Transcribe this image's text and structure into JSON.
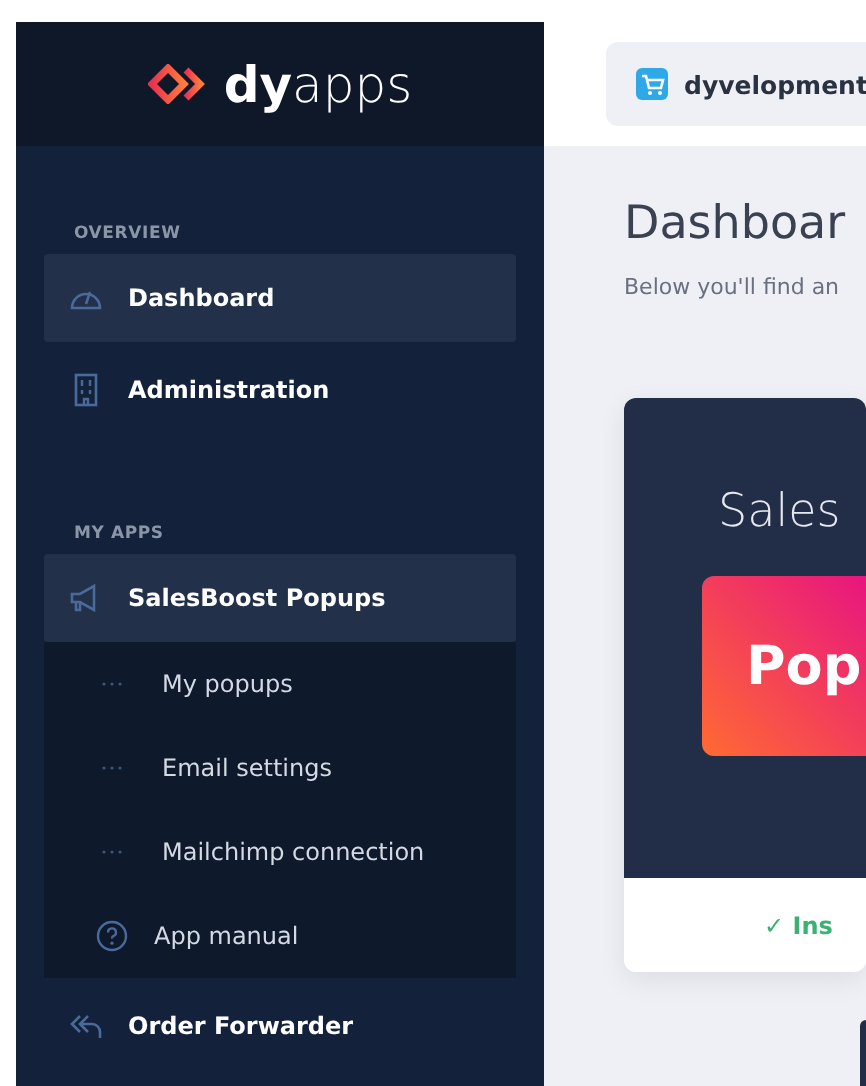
{
  "brand": {
    "bold": "dy",
    "light": "apps"
  },
  "shop": {
    "name": "dyvelopment"
  },
  "sidebar": {
    "sections": [
      {
        "heading": "OVERVIEW",
        "items": [
          {
            "label": "Dashboard",
            "kind": "gauge",
            "selected": true
          },
          {
            "label": "Administration",
            "kind": "building",
            "selected": false
          }
        ]
      },
      {
        "heading": "MY APPS",
        "items": [
          {
            "label": "SalesBoost Popups",
            "kind": "megaphone",
            "selected": true,
            "expanded": true,
            "children": [
              {
                "label": "My popups",
                "kind": "dots"
              },
              {
                "label": "Email settings",
                "kind": "dots"
              },
              {
                "label": "Mailchimp connection",
                "kind": "dots"
              },
              {
                "label": "App manual",
                "kind": "help"
              }
            ]
          },
          {
            "label": "Order Forwarder",
            "kind": "arrows",
            "selected": false
          }
        ]
      }
    ]
  },
  "main": {
    "title": "Dashboar",
    "subtitle": "Below you'll find an",
    "card": {
      "banner_title": "Sales",
      "banner_button": "Pop",
      "status": "✓ Ins"
    }
  }
}
